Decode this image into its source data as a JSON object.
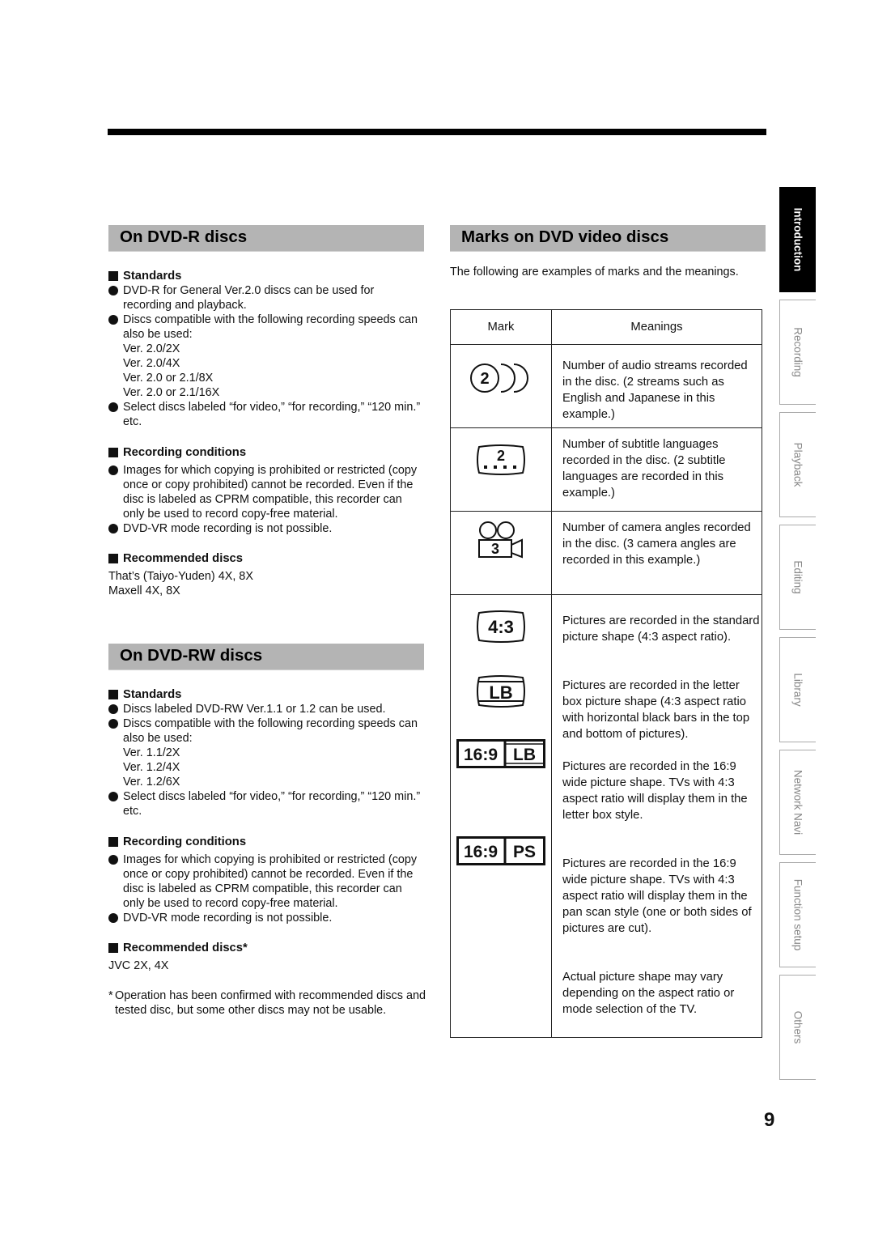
{
  "left": {
    "dvdr": {
      "title": "On DVD-R discs",
      "standards": {
        "heading": "Standards",
        "bullets": [
          "DVD-R for General Ver.2.0 discs can be used for recording and playback.",
          "Discs compatible with the following recording speeds can also be used:",
          "Select discs labeled “for video,” “for recording,” “120 min.” etc."
        ],
        "speeds": [
          "Ver. 2.0/2X",
          "Ver. 2.0/4X",
          "Ver. 2.0 or 2.1/8X",
          "Ver. 2.0 or 2.1/16X"
        ]
      },
      "conditions": {
        "heading": "Recording conditions",
        "bullets": [
          "Images for which copying is prohibited or restricted (copy once or copy prohibited) cannot be recorded. Even if the disc is labeled as CPRM compatible, this recorder can only be used to record copy-free material.",
          "DVD-VR mode recording is not possible."
        ]
      },
      "recommended": {
        "heading": "Recommended discs",
        "lines": [
          "That’s (Taiyo-Yuden) 4X, 8X",
          "Maxell 4X, 8X"
        ]
      }
    },
    "dvdrw": {
      "title": "On DVD-RW discs",
      "standards": {
        "heading": "Standards",
        "bullets": [
          "Discs labeled DVD-RW Ver.1.1 or 1.2 can be used.",
          "Discs compatible with the following recording speeds can also be used:",
          "Select discs labeled “for video,” “for recording,” “120 min.” etc."
        ],
        "speeds": [
          "Ver. 1.1/2X",
          "Ver. 1.2/4X",
          "Ver. 1.2/6X"
        ]
      },
      "conditions": {
        "heading": "Recording conditions",
        "bullets": [
          "Images for which copying is prohibited or restricted (copy once or copy prohibited) cannot be recorded. Even if the disc is labeled as CPRM compatible, this recorder can only be used to record copy-free material.",
          "DVD-VR mode recording is not possible."
        ]
      },
      "recommended": {
        "heading": "Recommended discs*",
        "lines": [
          "JVC 2X, 4X"
        ]
      },
      "footnote_mark": "*",
      "footnote": "Operation has been confirmed with recommended discs and tested disc, but some other discs may not be usable."
    }
  },
  "right": {
    "title": "Marks on DVD video discs",
    "intro": "The following are examples of marks and the meanings.",
    "table": {
      "headers": [
        "Mark",
        "Meanings"
      ],
      "rows": [
        {
          "icon": "audio-streams-icon",
          "mark_text": "2",
          "meaning": "Number of audio streams recorded in the disc. (2 streams such as English and Japanese in this example.)"
        },
        {
          "icon": "subtitle-languages-icon",
          "mark_text": "2",
          "meaning": "Number of subtitle languages recorded in the disc. (2 subtitle languages are recorded in this example.)"
        },
        {
          "icon": "camera-angles-icon",
          "mark_text": "3",
          "meaning": "Number of camera angles recorded in the disc. (3 camera angles are recorded in this example.)"
        },
        {
          "icon": "aspect-4-3-icon",
          "mark_text": "4:3",
          "meaning": "Pictures are recorded in the standard picture shape (4:3 aspect ratio)."
        },
        {
          "icon": "letterbox-icon",
          "mark_text": "LB",
          "meaning": "Pictures are recorded in the letter box picture shape (4:3 aspect ratio with horizontal black bars in the top and bottom of pictures)."
        },
        {
          "icon": "wide-16-9-lb-icon",
          "mark_text": [
            "16:9",
            "LB"
          ],
          "meaning": "Pictures are recorded in the 16:9 wide picture shape. TVs with 4:3 aspect ratio will display them in the letter box style."
        },
        {
          "icon": "wide-16-9-ps-icon",
          "mark_text": [
            "16:9",
            "PS"
          ],
          "meaning": "Pictures are recorded in the 16:9 wide picture shape. TVs with 4:3 aspect ratio will display them in the pan scan style (one or both sides of pictures are cut)."
        }
      ],
      "note": "Actual picture shape may vary depending on the aspect ratio or mode selection of the TV."
    }
  },
  "side_tabs": [
    {
      "label": "Introduction",
      "active": true
    },
    {
      "label": "Recording",
      "active": false
    },
    {
      "label": "Playback",
      "active": false
    },
    {
      "label": "Editing",
      "active": false
    },
    {
      "label": "Library",
      "active": false
    },
    {
      "label": "Network Navi",
      "active": false
    },
    {
      "label": "Function setup",
      "active": false
    },
    {
      "label": "Others",
      "active": false
    }
  ],
  "page_number": "9"
}
